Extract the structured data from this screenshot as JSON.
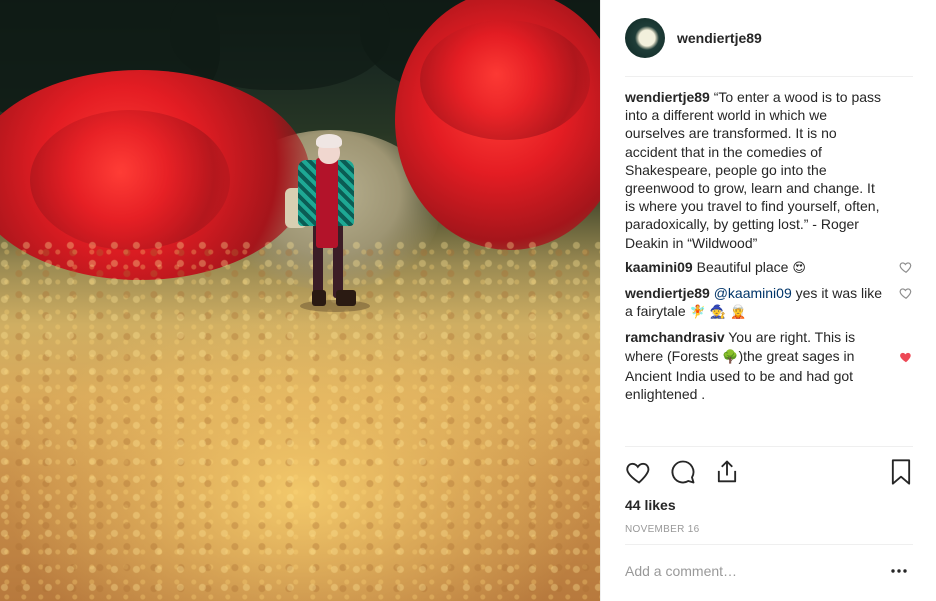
{
  "post": {
    "username": "wendiertje89",
    "caption": "“To enter a wood is to pass into a different world in which we ourselves are transformed. It is no accident that in the comedies of Shakespeare, people go into the greenwood to grow, learn and change. It is where you travel to find yourself, often, paradoxically, by getting lost.” - Roger Deakin in “Wildwood”"
  },
  "comments": [
    {
      "user": "kaamini09",
      "text": "Beautiful place",
      "emoji": "😍",
      "liked": false
    },
    {
      "user": "wendiertje89",
      "mention": "@kaamini09",
      "text": "yes it was like a fairytale",
      "emoji": "🧚 🧙 🧝",
      "liked": false
    },
    {
      "user": "ramchandrasiv",
      "text_before": "You are right. This is where (Forests ",
      "emoji": "🌳",
      "text_after": ")the great sages in Ancient India used to be and had got enlightened .",
      "liked": true
    }
  ],
  "actions": {
    "like_icon": "heart-outline-icon",
    "comment_icon": "speech-bubble-icon",
    "share_icon": "share-icon",
    "save_icon": "bookmark-icon"
  },
  "likes_text": "44 likes",
  "date_text": "NOVEMBER 16",
  "add_comment_placeholder": "Add a comment…",
  "colors": {
    "text": "#262626",
    "muted": "#999999",
    "mention": "#003569",
    "liked_heart": "#ed4956",
    "border": "#efefef"
  }
}
